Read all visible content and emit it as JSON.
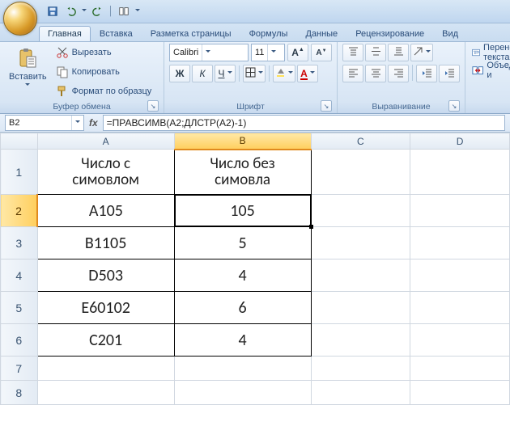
{
  "qat": {},
  "tabs": [
    "Главная",
    "Вставка",
    "Разметка страницы",
    "Формулы",
    "Данные",
    "Рецензирование",
    "Вид"
  ],
  "active_tab": 0,
  "ribbon": {
    "clipboard": {
      "paste": "Вставить",
      "cut": "Вырезать",
      "copy": "Копировать",
      "format_painter": "Формат по образцу",
      "group_label": "Буфер обмена"
    },
    "font": {
      "name": "Calibri",
      "size": "11",
      "group_label": "Шрифт"
    },
    "alignment": {
      "wrap": "Перенос текста",
      "merge": "Объединить и",
      "group_label": "Выравнивание"
    }
  },
  "namebox": "B2",
  "formula": "=ПРАВСИМВ(A2;ДЛСТР(A2)-1)",
  "columns": [
    "A",
    "B",
    "C",
    "D"
  ],
  "rows": [
    {
      "n": "1",
      "A_top": "Число с",
      "A_bottom": "симовлом",
      "B_top": "Число без",
      "B_bottom": "симовла"
    },
    {
      "n": "2",
      "A": "А105",
      "B": "105"
    },
    {
      "n": "3",
      "A": "В1105",
      "B": "5"
    },
    {
      "n": "4",
      "A": "D503",
      "B": "4"
    },
    {
      "n": "5",
      "A": "Е60102",
      "B": "6"
    },
    {
      "n": "6",
      "A": "С201",
      "B": "4"
    },
    {
      "n": "7"
    },
    {
      "n": "8"
    }
  ],
  "active_cell": {
    "row": 2,
    "col": "B"
  },
  "chart_data": {
    "type": "table",
    "columns": [
      "Число с симовлом",
      "Число без симовла"
    ],
    "rows": [
      [
        "А105",
        105
      ],
      [
        "В1105",
        5
      ],
      [
        "D503",
        4
      ],
      [
        "Е60102",
        6
      ],
      [
        "С201",
        4
      ]
    ]
  }
}
